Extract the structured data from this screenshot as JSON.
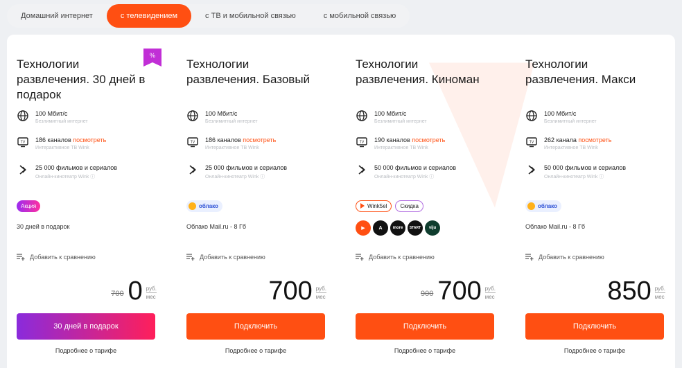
{
  "tabs": [
    {
      "label": "Домашний интернет",
      "active": false
    },
    {
      "label": "с телевидением",
      "active": true
    },
    {
      "label": "с ТВ и мобильной связью",
      "active": false
    },
    {
      "label": "с мобильной связью",
      "active": false
    }
  ],
  "colors": {
    "accent": "#ff4f12",
    "promo_start": "#8a2bdc",
    "promo_end": "#ff1f5a"
  },
  "cards": [
    {
      "title": "Технологии развлечения. 30 дней в подарок",
      "promo_badge": "%",
      "speed": "100 Мбит/с",
      "speed_sub": "Безлимитный интернет",
      "channels": "186 каналов",
      "channels_link": "посмотреть",
      "channels_sub": "Интерактивное ТВ Wink",
      "movies": "25 000 фильмов и сериалов",
      "movies_sub": "Онлайн-кинотеатр Wink",
      "badge": "Акция",
      "extra_line": "30 дней в подарок",
      "compare": "Добавить к сравнению",
      "old_price": "700",
      "price": "0",
      "unit_top": "руб.",
      "unit_bottom": "мес",
      "cta": "30 дней в подарок",
      "more": "Подробнее о тарифе"
    },
    {
      "title": "Технологии развлечения. Базовый",
      "speed": "100 Мбит/с",
      "speed_sub": "Безлимитный интернет",
      "channels": "186 каналов",
      "channels_link": "посмотреть",
      "channels_sub": "Интерактивное ТВ Wink",
      "movies": "25 000 фильмов и сериалов",
      "movies_sub": "Онлайн-кинотеатр Wink",
      "badge": "облако",
      "extra_line": "Облако Mail.ru - 8 Гб",
      "compare": "Добавить к сравнению",
      "price": "700",
      "unit_top": "руб.",
      "unit_bottom": "мес",
      "cta": "Подключить",
      "more": "Подробнее о тарифе"
    },
    {
      "title": "Технологии развлечения. Киноман",
      "speed": "100 Мбит/с",
      "speed_sub": "Безлимитный интернет",
      "channels": "190 каналов",
      "channels_link": "посмотреть",
      "channels_sub": "Интерактивное ТВ Wink",
      "movies": "50 000 фильмов и сериалов",
      "movies_sub": "Онлайн-кинотеатр Wink",
      "badge": "Wink5el",
      "badge2": "Скидка",
      "services": [
        "▶",
        "A",
        "more",
        "START",
        "viju"
      ],
      "compare": "Добавить к сравнению",
      "old_price": "900",
      "price": "700",
      "unit_top": "руб.",
      "unit_bottom": "мес",
      "cta": "Подключить",
      "more": "Подробнее о тарифе"
    },
    {
      "title": "Технологии развлечения. Макси",
      "speed": "100 Мбит/с",
      "speed_sub": "Безлимитный интернет",
      "channels": "262 канала",
      "channels_link": "посмотреть",
      "channels_sub": "Интерактивное ТВ Wink",
      "movies": "50 000 фильмов и сериалов",
      "movies_sub": "Онлайн-кинотеатр Wink",
      "badge": "облако",
      "extra_line": "Облако Mail.ru - 8 Гб",
      "compare": "Добавить к сравнению",
      "price": "850",
      "unit_top": "руб.",
      "unit_bottom": "мес",
      "cta": "Подключить",
      "more": "Подробнее о тарифе"
    }
  ]
}
